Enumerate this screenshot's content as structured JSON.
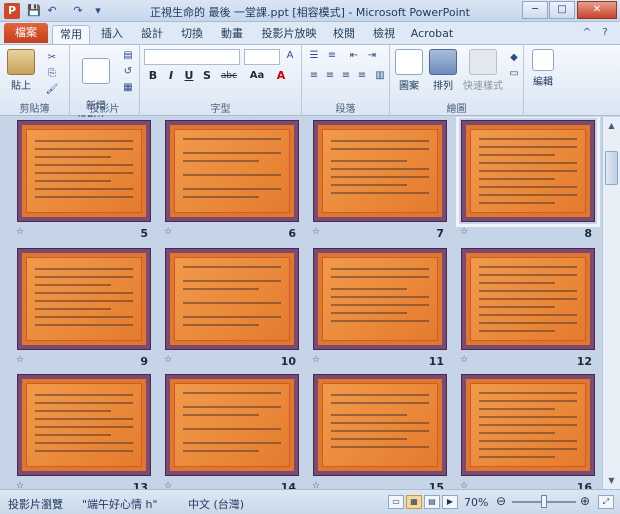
{
  "window": {
    "app_icon": "P",
    "title": "正視生命的 最後 一堂課.ppt [相容模式] - Microsoft PowerPoint",
    "minimize": "─",
    "maximize": "□",
    "close": "✕"
  },
  "qat": {
    "save": "💾",
    "undo": "↶",
    "redo": "↷",
    "customize": "▾"
  },
  "tabs": {
    "file": "檔案",
    "items": [
      "常用",
      "插入",
      "設計",
      "切換",
      "動畫",
      "投影片放映",
      "校閱",
      "檢視",
      "Acrobat"
    ],
    "active_index": 0,
    "help": "?",
    "collapse": "^"
  },
  "ribbon": {
    "clipboard": {
      "paste": "貼上",
      "label": "剪貼簿"
    },
    "slides": {
      "new_slide": "新增\n投影片 ▾",
      "label": "投影片"
    },
    "font": {
      "label": "字型",
      "bold": "B",
      "italic": "I",
      "underline": "U",
      "strike": "S",
      "shadow": "abc",
      "case": "Aa",
      "color": "A"
    },
    "paragraph": {
      "label": "段落"
    },
    "drawing": {
      "shapes": "圖案",
      "arrange": "排列",
      "quick_styles": "快速樣式",
      "label": "繪圖"
    },
    "editing": {
      "edit": "編輯",
      "label": ""
    }
  },
  "slides": [
    {
      "number": "5"
    },
    {
      "number": "6"
    },
    {
      "number": "7"
    },
    {
      "number": "8"
    },
    {
      "number": "9"
    },
    {
      "number": "10"
    },
    {
      "number": "11"
    },
    {
      "number": "12"
    },
    {
      "number": "13"
    },
    {
      "number": "14"
    },
    {
      "number": "15"
    },
    {
      "number": "16"
    }
  ],
  "slide_star": "☆",
  "selected_slide_index": 3,
  "status": {
    "view": "投影片瀏覽",
    "theme": "\"端午好心情 h\"",
    "language": "中文 (台灣)",
    "zoom": "70%",
    "zoom_out": "⊖",
    "zoom_in": "⊕",
    "zoom_fraction": 0.5
  },
  "colors": {
    "slide_bg": "#e2762a",
    "slide_frame": "#7a4a74",
    "file_tab": "#c4401c"
  }
}
